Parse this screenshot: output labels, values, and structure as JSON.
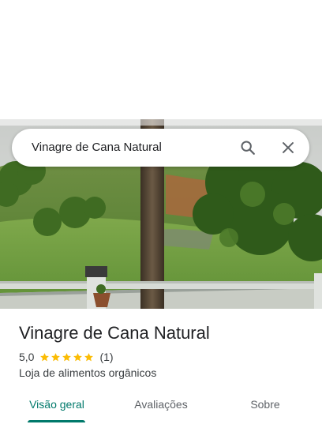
{
  "search": {
    "query": "Vinagre de Cana Natural"
  },
  "place": {
    "title": "Vinagre de Cana Natural",
    "rating": "5,0",
    "stars": 5,
    "review_count": "(1)",
    "category": "Loja de alimentos orgânicos"
  },
  "tabs": [
    {
      "label": "Visão geral",
      "active": true
    },
    {
      "label": "Avaliações",
      "active": false
    },
    {
      "label": "Sobre",
      "active": false
    }
  ],
  "colors": {
    "accent": "#00796b",
    "star": "#fbbc04"
  },
  "icons": {
    "search": "search-icon",
    "close": "close-icon",
    "star": "star-icon"
  }
}
